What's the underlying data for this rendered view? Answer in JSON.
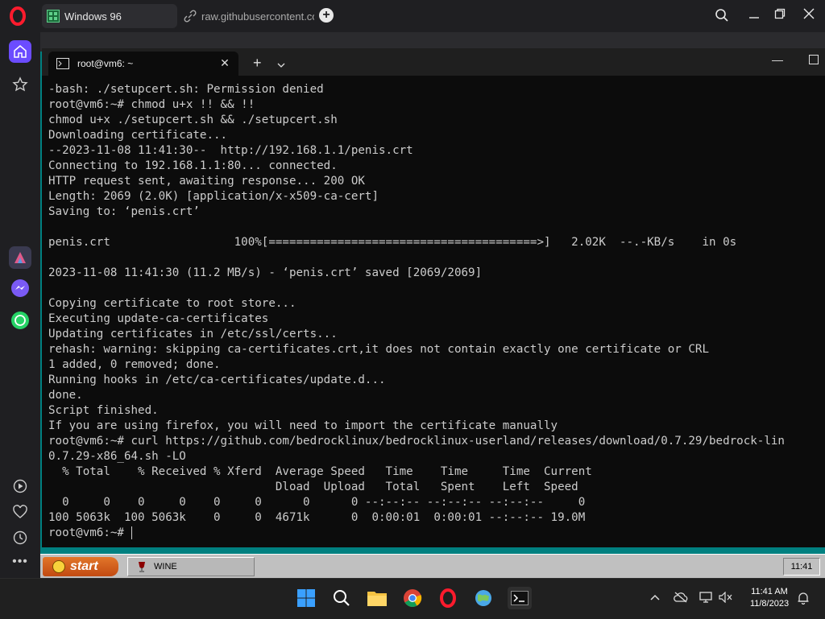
{
  "browser": {
    "tabs": [
      {
        "label": "Windows 96",
        "active": true
      },
      {
        "label": "raw.githubusercontent.com",
        "active": false
      }
    ]
  },
  "terminal": {
    "tab_title": "root@vm6: ~",
    "lines": [
      "-bash: ./setupcert.sh: Permission denied",
      "root@vm6:~# chmod u+x !! && !!",
      "chmod u+x ./setupcert.sh && ./setupcert.sh",
      "Downloading certificate...",
      "--2023-11-08 11:41:30--  http://192.168.1.1/penis.crt",
      "Connecting to 192.168.1.1:80... connected.",
      "HTTP request sent, awaiting response... 200 OK",
      "Length: 2069 (2.0K) [application/x-x509-ca-cert]",
      "Saving to: ‘penis.crt’",
      "",
      "penis.crt                  100%[=======================================>]   2.02K  --.-KB/s    in 0s",
      "",
      "2023-11-08 11:41:30 (11.2 MB/s) - ‘penis.crt’ saved [2069/2069]",
      "",
      "Copying certificate to root store...",
      "Executing update-ca-certificates",
      "Updating certificates in /etc/ssl/certs...",
      "rehash: warning: skipping ca-certificates.crt,it does not contain exactly one certificate or CRL",
      "1 added, 0 removed; done.",
      "Running hooks in /etc/ca-certificates/update.d...",
      "done.",
      "Script finished.",
      "If you are using firefox, you will need to import the certificate manually",
      "root@vm6:~# curl https://github.com/bedrocklinux/bedrocklinux-userland/releases/download/0.7.29/bedrock-lin",
      "0.7.29-x86_64.sh -LO",
      "  % Total    % Received % Xferd  Average Speed   Time    Time     Time  Current",
      "                                 Dload  Upload   Total   Spent    Left  Speed",
      "  0     0    0     0    0     0      0      0 --:--:-- --:--:-- --:--:--     0",
      "100 5063k  100 5063k    0     0  4671k      0  0:00:01  0:00:01 --:--:-- 19.0M"
    ],
    "prompt": "root@vm6:~# "
  },
  "w96_taskbar": {
    "start_label": "start",
    "task_label": "WINE",
    "clock": "11:41"
  },
  "windows_taskbar": {
    "time": "11:41 AM",
    "date": "11/8/2023"
  },
  "colors": {
    "terminal_bg": "#0c0c0c",
    "terminal_fg": "#cccccc",
    "opera_red": "#ff1b2d",
    "desktop_teal": "#008080"
  }
}
